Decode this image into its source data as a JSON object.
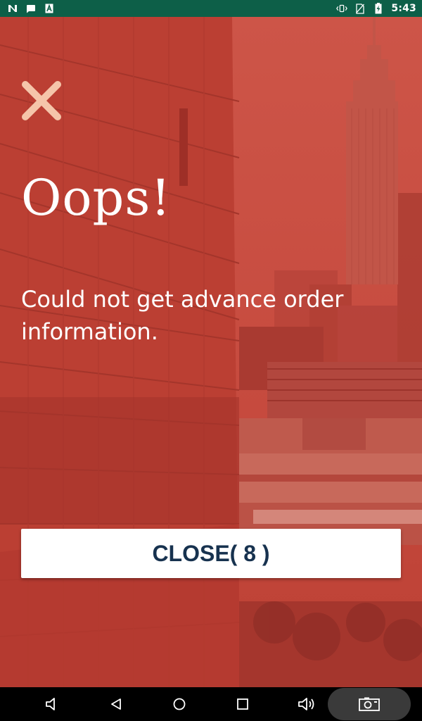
{
  "status_bar": {
    "time": "5:43",
    "left_icons": [
      "n-notification-icon",
      "message-notification-icon",
      "a-notification-icon"
    ],
    "right_icons": [
      "vibrate-icon",
      "no-sim-icon",
      "battery-charging-icon"
    ]
  },
  "dialog": {
    "title": "Oops!",
    "message": "Could not get advance order information.",
    "close_button_label": "CLOSE( 8 )",
    "close_icon": "close-x-icon"
  },
  "navigation_bar": {
    "buttons": [
      "volume-down-icon",
      "back-icon",
      "home-icon",
      "recents-icon",
      "volume-up-icon",
      "screenshot-icon"
    ]
  },
  "colors": {
    "status_bar": "#0d5f48",
    "overlay_red": "#c4473a",
    "close_icon": "#f5c5aa",
    "button_text": "#17324f",
    "nav_bar": "#000000"
  }
}
